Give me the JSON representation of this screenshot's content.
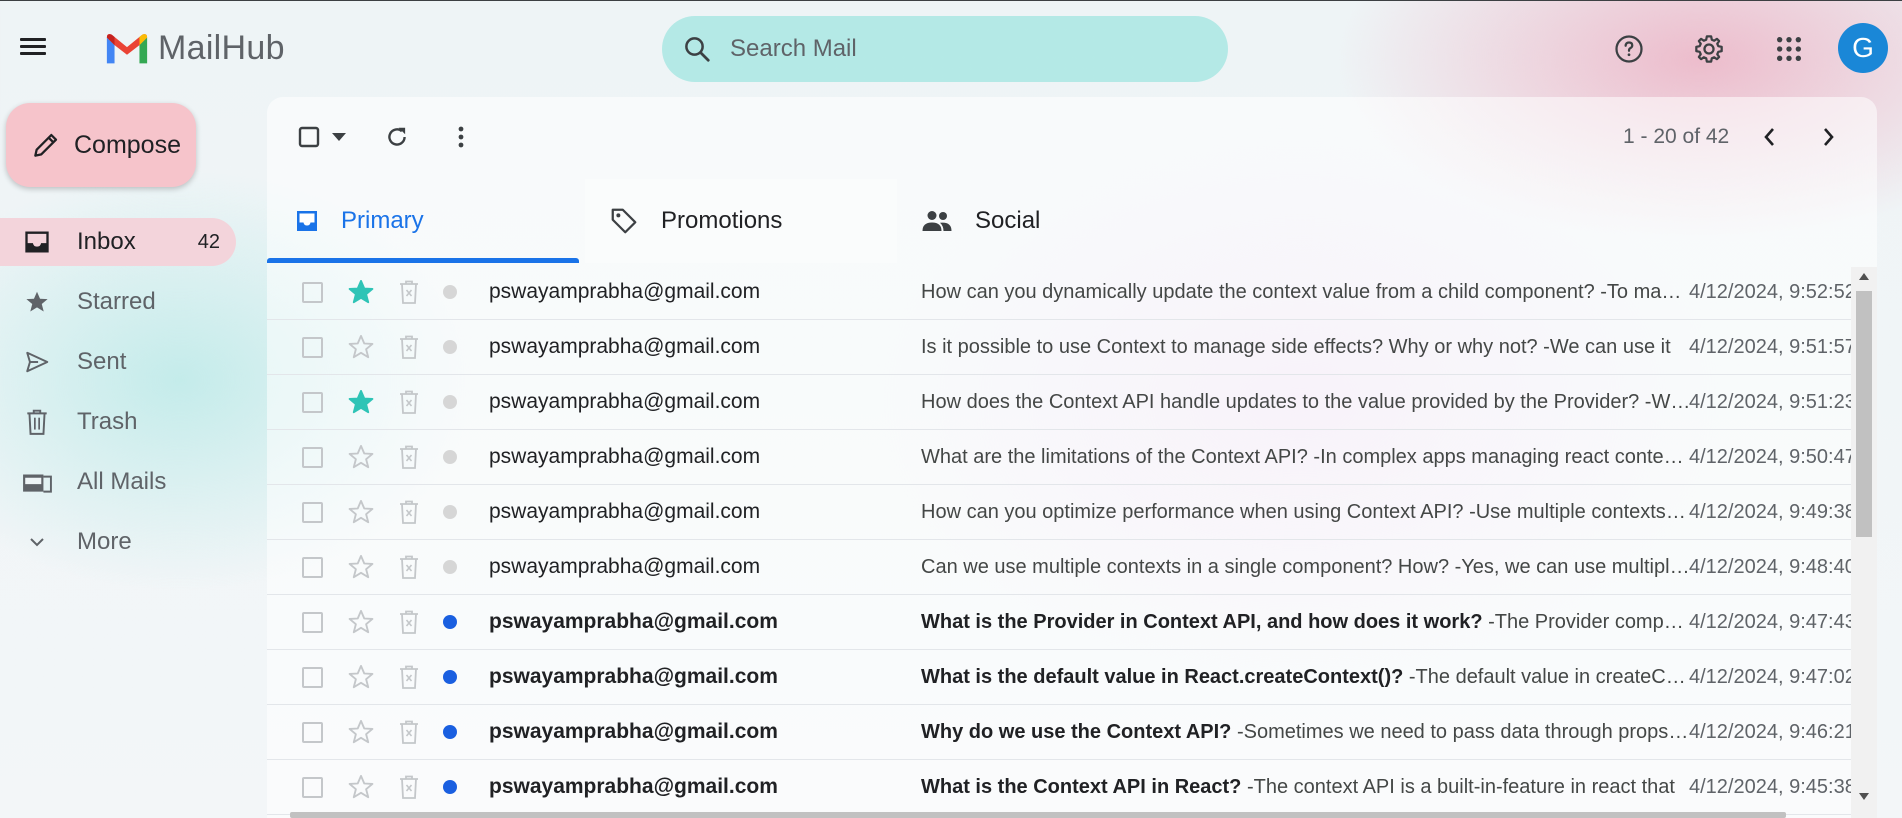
{
  "app": {
    "name": "MailHub"
  },
  "search": {
    "placeholder": "Search Mail"
  },
  "user": {
    "avatar_letter": "G"
  },
  "compose": {
    "label": "Compose"
  },
  "sidebar": {
    "items": [
      {
        "label": "Inbox",
        "icon": "inbox-icon",
        "count": "42",
        "active": true
      },
      {
        "label": "Starred",
        "icon": "star-icon"
      },
      {
        "label": "Sent",
        "icon": "send-icon"
      },
      {
        "label": "Trash",
        "icon": "trash-icon"
      },
      {
        "label": "All Mails",
        "icon": "all-mail-icon"
      },
      {
        "label": "More",
        "icon": "chevron-down-icon"
      }
    ]
  },
  "toolbar": {
    "page_info": "1 - 20 of 42"
  },
  "tabs": [
    {
      "label": "Primary",
      "icon": "inbox-icon",
      "selected": true
    },
    {
      "label": "Promotions",
      "icon": "tag-icon"
    },
    {
      "label": "Social",
      "icon": "people-icon"
    }
  ],
  "colors": {
    "accent": "#1a73e8",
    "star_active": "#2ec4b6",
    "unread_dot": "#1a5fe0",
    "read_dot": "#d6d6d6",
    "compose_bg": "#f6c4cb"
  },
  "emails": [
    {
      "sender": "pswayamprabha@gmail.com",
      "subject": "How can you dynamically update the context value from a child component?",
      "snippet": " -To make the context value updatable, we can pass a function",
      "date": "4/12/2024, 9:52:52",
      "starred": true,
      "unread": false
    },
    {
      "sender": "pswayamprabha@gmail.com",
      "subject": "Is it possible to use Context to manage side effects? Why or why not?",
      "snippet": " -We can use it",
      "date": "4/12/2024, 9:51:57",
      "starred": false,
      "unread": false
    },
    {
      "sender": "pswayamprabha@gmail.com",
      "subject": "How does the Context API handle updates to the value provided by the Provider?",
      "snippet": " -When the value changes",
      "date": "4/12/2024, 9:51:23",
      "starred": true,
      "unread": false
    },
    {
      "sender": "pswayamprabha@gmail.com",
      "subject": "What are the limitations of the Context API?",
      "snippet": " -In complex apps managing react context can become difficult",
      "date": "4/12/2024, 9:50:47",
      "starred": false,
      "unread": false
    },
    {
      "sender": "pswayamprabha@gmail.com",
      "subject": "How can you optimize performance when using Context API?",
      "snippet": " -Use multiple contexts and memoize values",
      "date": "4/12/2024, 9:49:38",
      "starred": false,
      "unread": false
    },
    {
      "sender": "pswayamprabha@gmail.com",
      "subject": "Can we use multiple contexts in a single component? How?",
      "snippet": " -Yes, we can use multiple contexts by nesting",
      "date": "4/12/2024, 9:48:40",
      "starred": false,
      "unread": false
    },
    {
      "sender": "pswayamprabha@gmail.com",
      "subject": "What is the Provider in Context API, and how does it work?",
      "snippet": " -The Provider component supplies the value",
      "date": "4/12/2024, 9:47:43",
      "starred": false,
      "unread": true
    },
    {
      "sender": "pswayamprabha@gmail.com",
      "subject": "What is the default value in React.createContext()?",
      "snippet": " -The default value in createContext is used when",
      "date": "4/12/2024, 9:47:02",
      "starred": false,
      "unread": true
    },
    {
      "sender": "pswayamprabha@gmail.com",
      "subject": "Why do we use the Context API?",
      "snippet": " -Sometimes we need to pass data through props at many levels",
      "date": "4/12/2024, 9:46:21",
      "starred": false,
      "unread": true
    },
    {
      "sender": "pswayamprabha@gmail.com",
      "subject": "What is the Context API in React?",
      "snippet": " -The context API is a built-in-feature in react that",
      "date": "4/12/2024, 9:45:38",
      "starred": false,
      "unread": true
    }
  ]
}
